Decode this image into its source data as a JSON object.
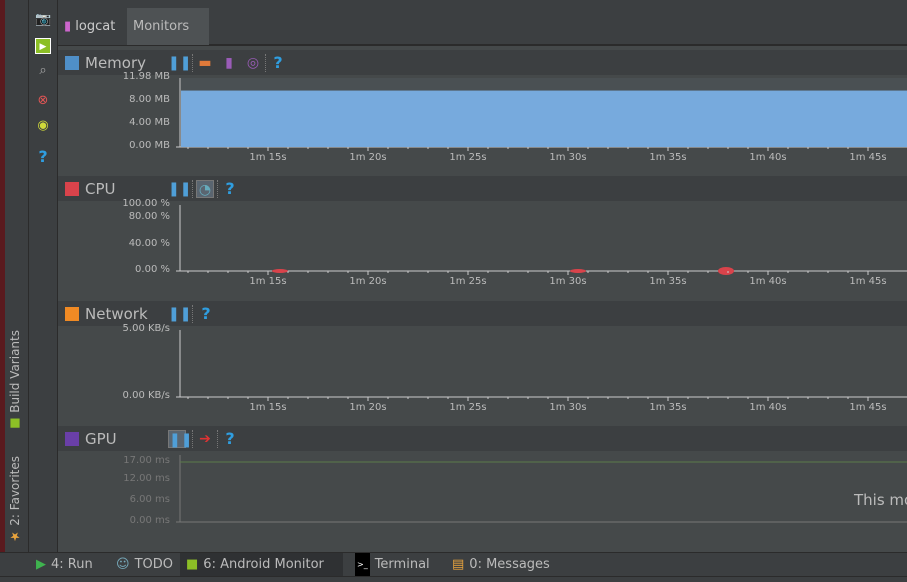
{
  "sidebar": {
    "build_variants": "Build Variants",
    "favorites": "2: Favorites"
  },
  "tabs": [
    {
      "label": "logcat"
    },
    {
      "label": "Monitors",
      "active": true
    }
  ],
  "monitors": {
    "memory": {
      "title": "Memory",
      "y_ticks": [
        "11.98 MB",
        "8.00 MB",
        "4.00 MB",
        "0.00 MB"
      ],
      "fill_value_mb": 9.8,
      "y_max_mb": 11.98,
      "color": "#77aadd"
    },
    "cpu": {
      "title": "CPU",
      "y_ticks": [
        "100.00 %",
        "80.00 %",
        "40.00 %",
        "0.00 %"
      ]
    },
    "network": {
      "title": "Network",
      "y_ticks": [
        "5.00 KB/s",
        "0.00 KB/s"
      ]
    },
    "gpu": {
      "title": "GPU",
      "y_ticks": [
        "17.00 ms",
        "12.00 ms",
        "6.00 ms",
        "0.00 ms"
      ],
      "message": "This mo"
    },
    "x_ticks": [
      "1m 15s",
      "1m 20s",
      "1m 25s",
      "1m 30s",
      "1m 35s",
      "1m 40s",
      "1m 45s"
    ],
    "help": "?"
  },
  "bottom_tabs": [
    {
      "label": "4: Run"
    },
    {
      "label": "TODO"
    },
    {
      "label": "6: Android Monitor",
      "active": true
    },
    {
      "label": "Terminal"
    },
    {
      "label": "0: Messages"
    }
  ]
}
